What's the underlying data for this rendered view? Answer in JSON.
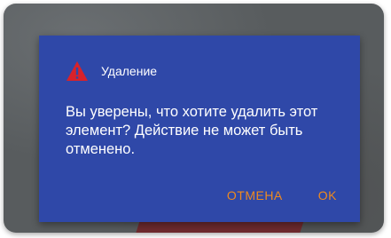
{
  "dialog": {
    "title": "Удаление",
    "message": "Вы уверены, что хотите удалить этот элемент? Действие не может быть отменено.",
    "buttons": {
      "cancel_label": "ОТМЕНА",
      "ok_label": "OK"
    },
    "icon": "warning-triangle-icon"
  },
  "colors": {
    "dialog_background": "#2f48a8",
    "button_text": "#ef8a1e",
    "warning_icon": "#d8222a",
    "text": "#ffffff",
    "overlay": "#585c5e"
  }
}
